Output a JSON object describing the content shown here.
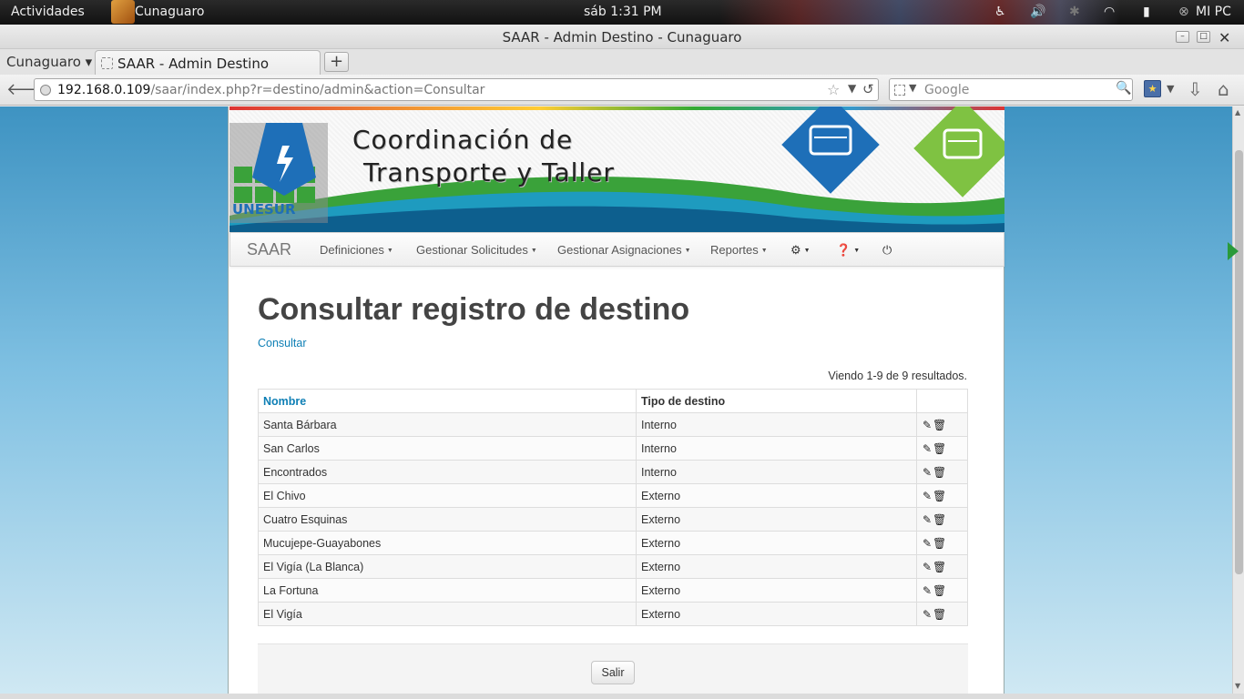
{
  "topbar": {
    "activities": "Actividades",
    "app_name": "Cunaguaro",
    "clock": "sáb  1:31 PM",
    "user": "MI PC"
  },
  "window": {
    "title": "SAAR - Admin Destino - Cunaguaro"
  },
  "tabs": {
    "group_label": "Cunaguaro ▾",
    "active_tab": "SAAR - Admin Destino",
    "new_tab": "+"
  },
  "urlbar": {
    "host": "192.168.0.109",
    "path": "/saar/index.php?r=destino/admin&action=Consultar"
  },
  "search": {
    "placeholder": "Google"
  },
  "banner": {
    "line1": "Coordinación de",
    "line2": "Transporte y Taller",
    "logo_text": "UNESUR"
  },
  "appnav": {
    "brand": "SAAR",
    "items": [
      {
        "label": "Definiciones"
      },
      {
        "label": "Gestionar Solicitudes"
      },
      {
        "label": "Gestionar Asignaciones"
      },
      {
        "label": "Reportes"
      }
    ],
    "icons": [
      "gear-icon",
      "question-icon",
      "power-icon"
    ]
  },
  "content": {
    "title": "Consultar registro de destino",
    "breadcrumb": "Consultar",
    "summary": "Viendo 1-9 de 9 resultados.",
    "columns": [
      "Nombre",
      "Tipo de destino",
      ""
    ],
    "rows": [
      {
        "nombre": "Santa Bárbara",
        "tipo": "Interno"
      },
      {
        "nombre": "San Carlos",
        "tipo": "Interno"
      },
      {
        "nombre": "Encontrados",
        "tipo": "Interno"
      },
      {
        "nombre": "El Chivo",
        "tipo": "Externo"
      },
      {
        "nombre": "Cuatro Esquinas",
        "tipo": "Externo"
      },
      {
        "nombre": "Mucujepe-Guayabones",
        "tipo": "Externo"
      },
      {
        "nombre": "El Vigía (La Blanca)",
        "tipo": "Externo"
      },
      {
        "nombre": "La Fortuna",
        "tipo": "Externo"
      },
      {
        "nombre": "El Vigía",
        "tipo": "Externo"
      }
    ],
    "exit_button": "Salir"
  },
  "colors": {
    "link": "#0e7fb5",
    "logo_blue": "#1e6fb8",
    "logo_green": "#5bb033"
  }
}
